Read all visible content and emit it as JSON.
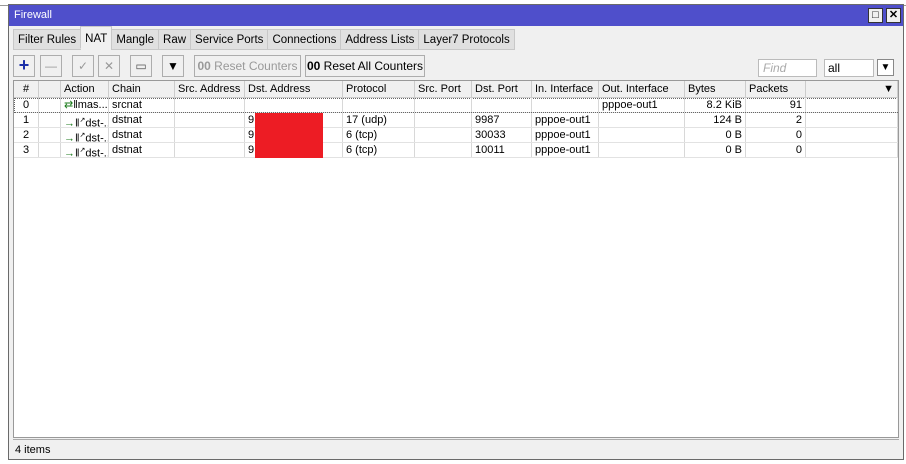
{
  "window": {
    "title": "Firewall"
  },
  "tabs": [
    "Filter Rules",
    "NAT",
    "Mangle",
    "Raw",
    "Service Ports",
    "Connections",
    "Address Lists",
    "Layer7 Protocols"
  ],
  "toolbar": {
    "reset_counters": "Reset Counters",
    "reset_all_counters": "Reset All Counters",
    "counter_prefix": "00",
    "find_placeholder": "Find",
    "filter_value": "all"
  },
  "columns": [
    "#",
    "",
    "Action",
    "Chain",
    "Src. Address",
    "Dst. Address",
    "Protocol",
    "Src. Port",
    "Dst. Port",
    "In. Interface",
    "Out. Interface",
    "Bytes",
    "Packets"
  ],
  "rows": [
    {
      "num": "0",
      "action": "mas...",
      "chain": "srcnat",
      "src": "",
      "dst": "",
      "protocol": "",
      "src_port": "",
      "dst_port": "",
      "in_if": "",
      "out_if": "pppoe-out1",
      "bytes": "8.2 KiB",
      "packets": "91"
    },
    {
      "num": "1",
      "action": "dst-...",
      "chain": "dstnat",
      "src": "",
      "dst": "9",
      "protocol": "17 (udp)",
      "src_port": "",
      "dst_port": "9987",
      "in_if": "pppoe-out1",
      "out_if": "",
      "bytes": "124 B",
      "packets": "2"
    },
    {
      "num": "2",
      "action": "dst-...",
      "chain": "dstnat",
      "src": "",
      "dst": "9",
      "protocol": "6 (tcp)",
      "src_port": "",
      "dst_port": "30033",
      "in_if": "pppoe-out1",
      "out_if": "",
      "bytes": "0 B",
      "packets": "0"
    },
    {
      "num": "3",
      "action": "dst-...",
      "chain": "dstnat",
      "src": "",
      "dst": "9",
      "protocol": "6 (tcp)",
      "src_port": "",
      "dst_port": "10011",
      "in_if": "pppoe-out1",
      "out_if": "",
      "bytes": "0 B",
      "packets": "0"
    }
  ],
  "status": "4 items"
}
